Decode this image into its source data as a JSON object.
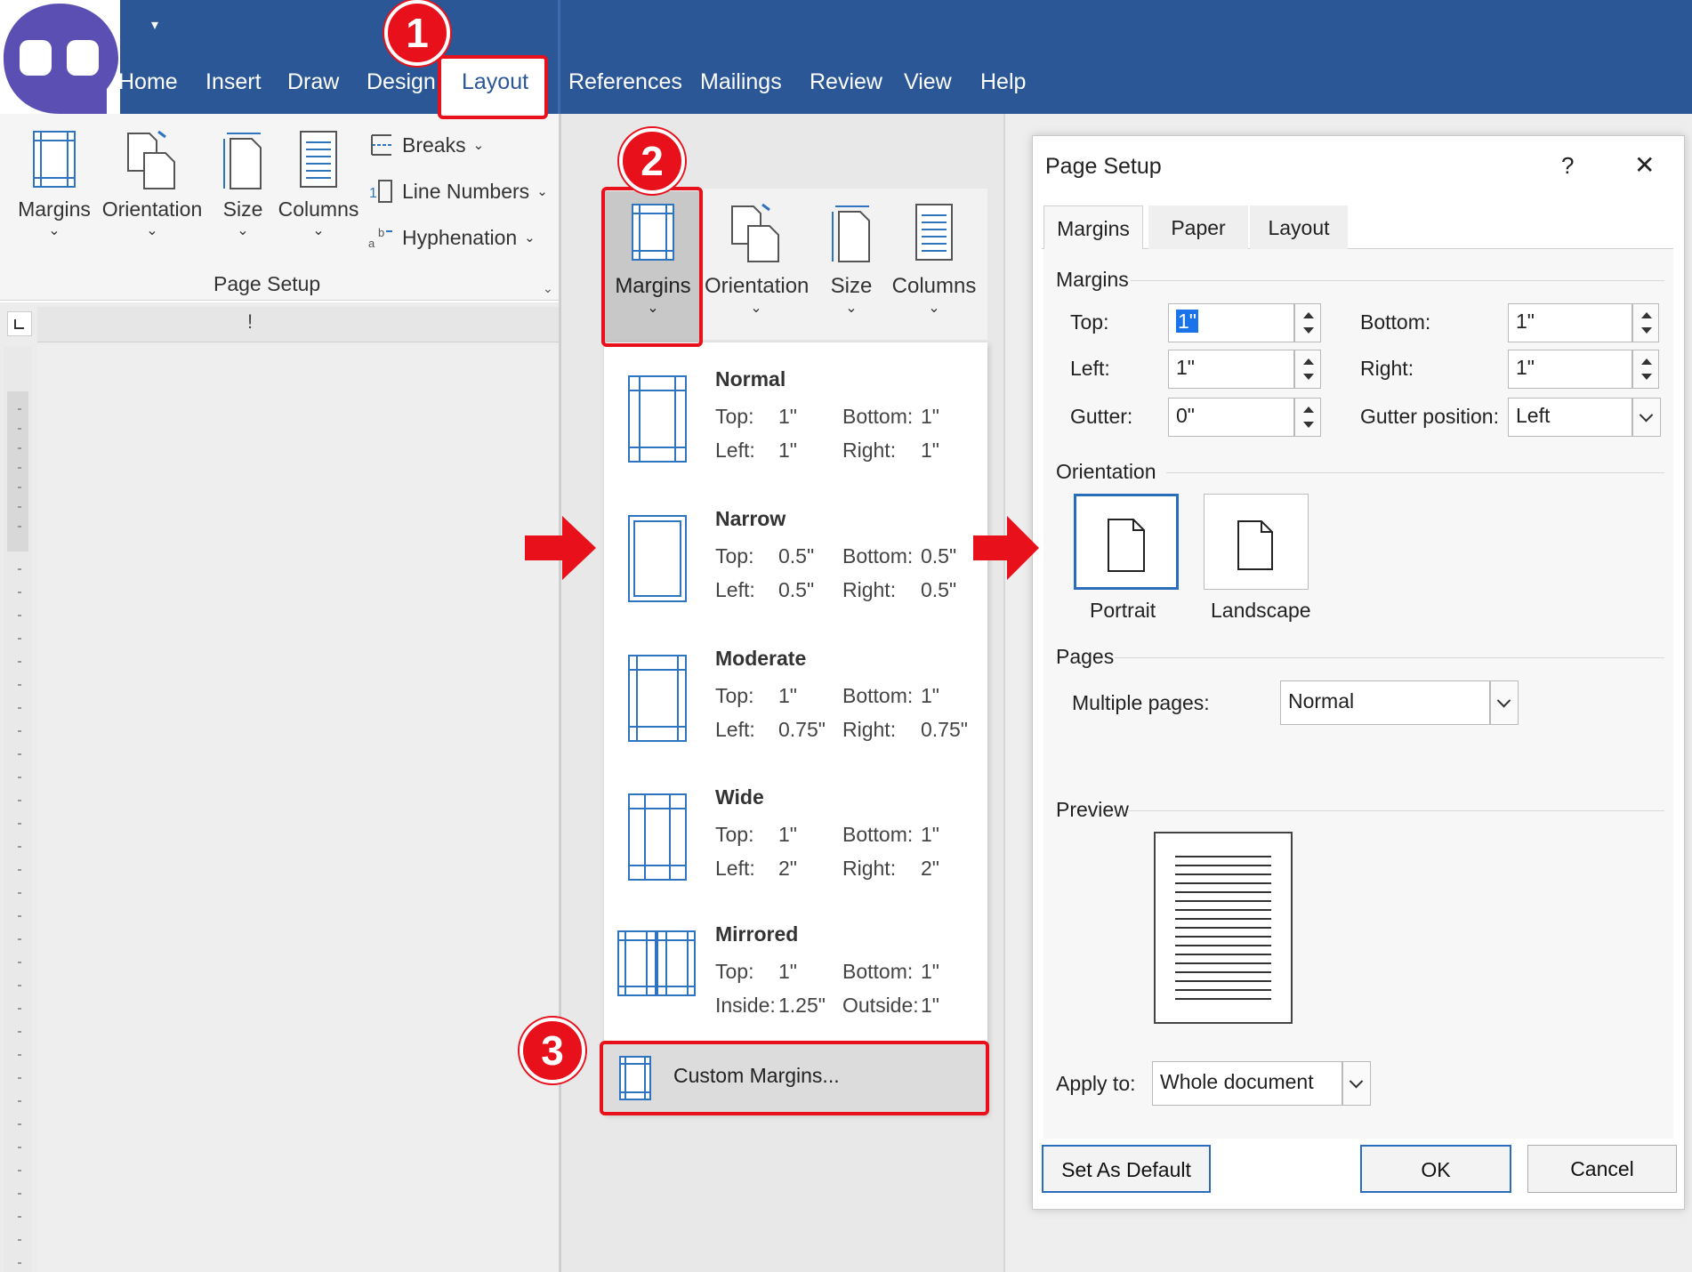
{
  "ribbon": {
    "tabs": [
      "Home",
      "Insert",
      "Draw",
      "Design",
      "Layout",
      "References",
      "Mailings",
      "Review",
      "View",
      "Help"
    ],
    "active_tab": "Layout",
    "quick_access": "▾"
  },
  "panel1": {
    "commands": {
      "margins": "Margins",
      "orientation": "Orientation",
      "size": "Size",
      "columns": "Columns"
    },
    "small_commands": {
      "breaks": "Breaks",
      "line_numbers": "Line Numbers",
      "hyphenation": "Hyphenation"
    },
    "group_label": "Page Setup",
    "ruler_mark": "!"
  },
  "panel2": {
    "commands": {
      "margins": "Margins",
      "orientation": "Orientation",
      "size": "Size",
      "columns": "Columns"
    },
    "presets": [
      {
        "name": "Normal",
        "k1": "Top:",
        "v1": "1\"",
        "k2": "Bottom:",
        "v2": "1\"",
        "k3": "Left:",
        "v3": "1\"",
        "k4": "Right:",
        "v4": "1\""
      },
      {
        "name": "Narrow",
        "k1": "Top:",
        "v1": "0.5\"",
        "k2": "Bottom:",
        "v2": "0.5\"",
        "k3": "Left:",
        "v3": "0.5\"",
        "k4": "Right:",
        "v4": "0.5\""
      },
      {
        "name": "Moderate",
        "k1": "Top:",
        "v1": "1\"",
        "k2": "Bottom:",
        "v2": "1\"",
        "k3": "Left:",
        "v3": "0.75\"",
        "k4": "Right:",
        "v4": "0.75\""
      },
      {
        "name": "Wide",
        "k1": "Top:",
        "v1": "1\"",
        "k2": "Bottom:",
        "v2": "1\"",
        "k3": "Left:",
        "v3": "2\"",
        "k4": "Right:",
        "v4": "2\""
      },
      {
        "name": "Mirrored",
        "k1": "Top:",
        "v1": "1\"",
        "k2": "Bottom:",
        "v2": "1\"",
        "k3": "Inside:",
        "v3": "1.25\"",
        "k4": "Outside:",
        "v4": "1\""
      }
    ],
    "custom_margins": "Custom Margins..."
  },
  "dialog": {
    "title": "Page Setup",
    "help": "?",
    "close": "✕",
    "tabs": [
      "Margins",
      "Paper",
      "Layout"
    ],
    "active_tab": "Margins",
    "margins_group": "Margins",
    "top_label": "Top:",
    "top_value": "1\"",
    "bottom_label": "Bottom:",
    "bottom_value": "1\"",
    "left_label": "Left:",
    "left_value": "1\"",
    "right_label": "Right:",
    "right_value": "1\"",
    "gutter_label": "Gutter:",
    "gutter_value": "0\"",
    "gutter_pos_label": "Gutter position:",
    "gutter_pos_value": "Left",
    "orientation_group": "Orientation",
    "portrait": "Portrait",
    "landscape": "Landscape",
    "orientation_selected": "Portrait",
    "pages_group": "Pages",
    "multiple_pages_label": "Multiple pages:",
    "multiple_pages_value": "Normal",
    "preview_group": "Preview",
    "apply_to_label": "Apply to:",
    "apply_to_value": "Whole document",
    "set_default": "Set As Default",
    "ok": "OK",
    "cancel": "Cancel"
  },
  "annotations": {
    "step1": "1",
    "step2": "2",
    "step3": "3",
    "color": "#e8101b"
  },
  "colors": {
    "title_bar": "#2b5797",
    "accent": "#2a6ebb",
    "highlight": "#e8101b"
  }
}
